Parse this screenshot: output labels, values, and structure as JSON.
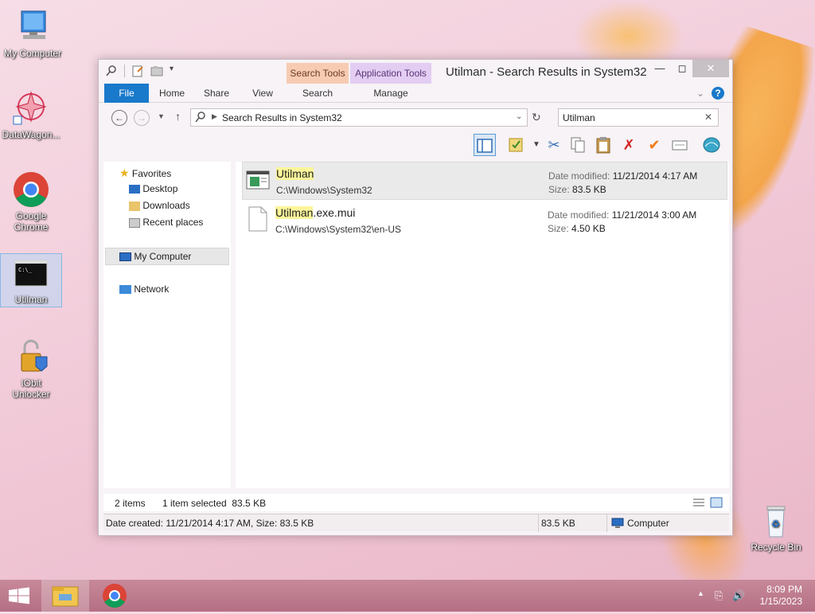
{
  "desktop": {
    "icons": [
      {
        "label": "My Computer"
      },
      {
        "label": "DataWagon..."
      },
      {
        "label": "Google Chrome"
      },
      {
        "label": "Utilman"
      },
      {
        "label": "IObit Unlocker"
      },
      {
        "label": "Recycle Bin"
      }
    ]
  },
  "window": {
    "title": "Utilman - Search Results in System32",
    "context_tabs": {
      "search_tools": "Search Tools",
      "application_tools": "Application Tools"
    },
    "ribbon_tabs": [
      "File",
      "Home",
      "Share",
      "View",
      "Search",
      "Manage"
    ],
    "address": "Search Results in System32",
    "search_value": "Utilman",
    "nav": {
      "favorites": "Favorites",
      "desktop": "Desktop",
      "downloads": "Downloads",
      "recent": "Recent places",
      "my_computer": "My Computer",
      "network": "Network"
    },
    "files": [
      {
        "name_highlight": "Utilman",
        "name_rest": "",
        "path": "C:\\Windows\\System32",
        "date_label": "Date modified:",
        "date": "11/21/2014 4:17 AM",
        "size_label": "Size:",
        "size": "83.5 KB"
      },
      {
        "name_highlight": "Utilman",
        "name_rest": ".exe.mui",
        "path": "C:\\Windows\\System32\\en-US",
        "date_label": "Date modified:",
        "date": "11/21/2014 3:00 AM",
        "size_label": "Size:",
        "size": "4.50 KB"
      }
    ],
    "status": {
      "items": "2 items",
      "selected": "1 item selected  83.5 KB",
      "details": "Date created: 11/21/2014 4:17 AM, Size: 83.5 KB",
      "size": "83.5 KB",
      "location": "Computer"
    }
  },
  "taskbar": {
    "time": "8:09 PM",
    "date": "1/15/2023"
  },
  "colors": {
    "file_tab": "#1979ca",
    "search_tools": "#f7cbb2",
    "application_tools": "#e3cdf2",
    "highlight": "#fcf59a"
  }
}
